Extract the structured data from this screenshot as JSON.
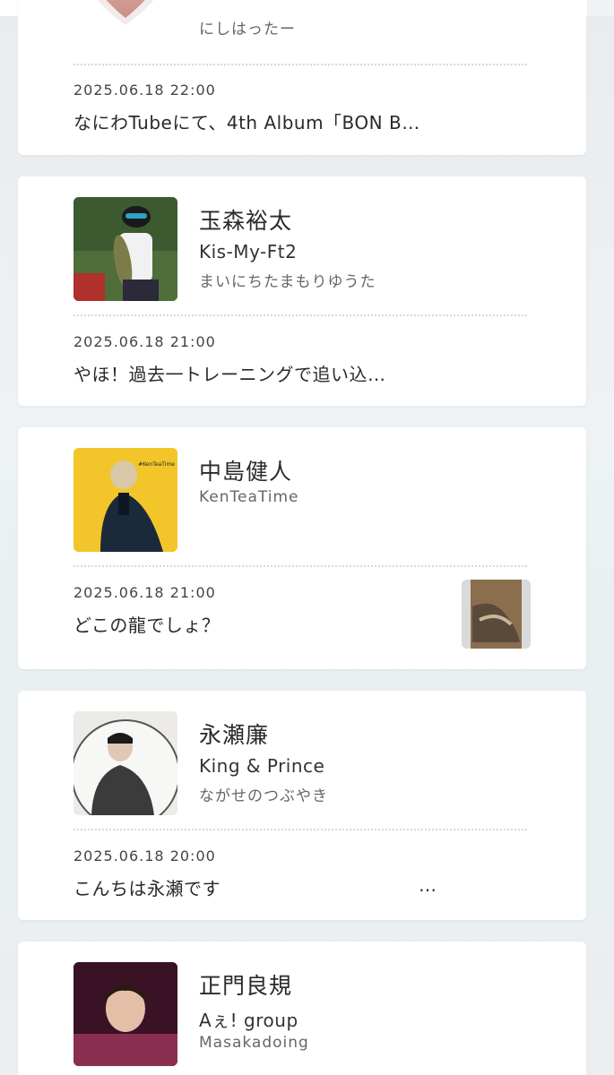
{
  "posts": [
    {
      "blog": "にしはったー",
      "date": "2025.06.18 22:00",
      "excerpt": "なにわTubeにて、4th Album「BON B…"
    },
    {
      "name": "玉森裕太",
      "group": "Kis-My-Ft2",
      "blog": "まいにちたまもりゆうた",
      "date": "2025.06.18 21:00",
      "excerpt": "やほ！過去一トレーニングで追い込…"
    },
    {
      "name": "中島健人",
      "blog": "KenTeaTime",
      "avatar_text": "#KenTeaTime",
      "date": "2025.06.18 21:00",
      "excerpt": "どこの龍でしょ？"
    },
    {
      "name": "永瀬廉",
      "group": "King & Prince",
      "blog": "ながせのつぶやき",
      "date": "2025.06.18 20:00",
      "excerpt": "こんちは永瀬です",
      "trailing": "…"
    },
    {
      "name": "正門良規",
      "group": "Aぇ! group",
      "blog": "Masakadoing"
    }
  ],
  "colors": {
    "background": "#eceff1",
    "card": "#ffffff",
    "divider": "#d8d8d8"
  }
}
